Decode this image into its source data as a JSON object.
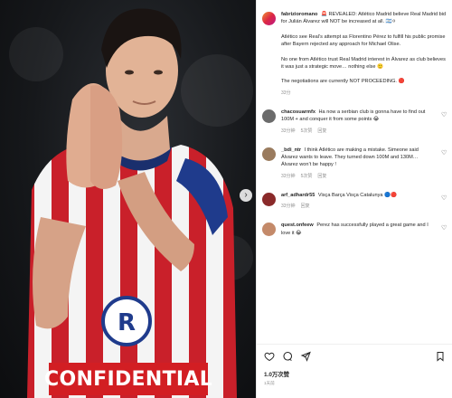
{
  "media": {
    "banner_text": "CONFIDENTIAL",
    "next_arrow_glyph": "›"
  },
  "post": {
    "author": "fabrizioromano",
    "caption_lead": "🚨 REVEALED: Atlético Madrid believe Real Madrid bid for Julián Álvarez will NOT be increased at all. 🇦🇷⚪",
    "caption_p2": "Atlético see Real’s attempt as Florentino Pérez to fulfill his public promise after Bayern rejected any approach for Michael Olise.",
    "caption_p3": "No one from Atlético trust Real Madrid interest in Álvarez as club believes it was just a strategic move… nothing else 🙂",
    "caption_p4": "The negotiations are currently NOT PROCEEDING. 🔴",
    "caption_time": "33分"
  },
  "comments": [
    {
      "user": "chacosuarmfx",
      "text": "Ha now a serbian club is gonna have to find out 100M + and conquer it from some points 😂",
      "time": "33分钟",
      "likes": "5次赞",
      "reply": "回复"
    },
    {
      "user": "_bdi_ntr",
      "text": "I think Atlético are making a mistake. Simeone said Álvarez wants to leave. They turned down 100M and 130M… Álvarez won’t be happy !",
      "time": "33分钟",
      "likes": "5次赞",
      "reply": "回复"
    },
    {
      "user": "arf_adhardr55",
      "text": "Visça Barça Visça Catalunya 🔵🔴",
      "time": "33分钟",
      "likes": "",
      "reply": "回复"
    },
    {
      "user": "quest.onfeew",
      "text": "Perez has successfully played a great game and I love it 😂",
      "time": "",
      "likes": "",
      "reply": ""
    }
  ],
  "actions": {
    "likes_text": "1.0万次赞",
    "date_text": "1天前"
  },
  "colors": {
    "banner_red": "#d21e23",
    "accent_red": "#ed4956"
  }
}
